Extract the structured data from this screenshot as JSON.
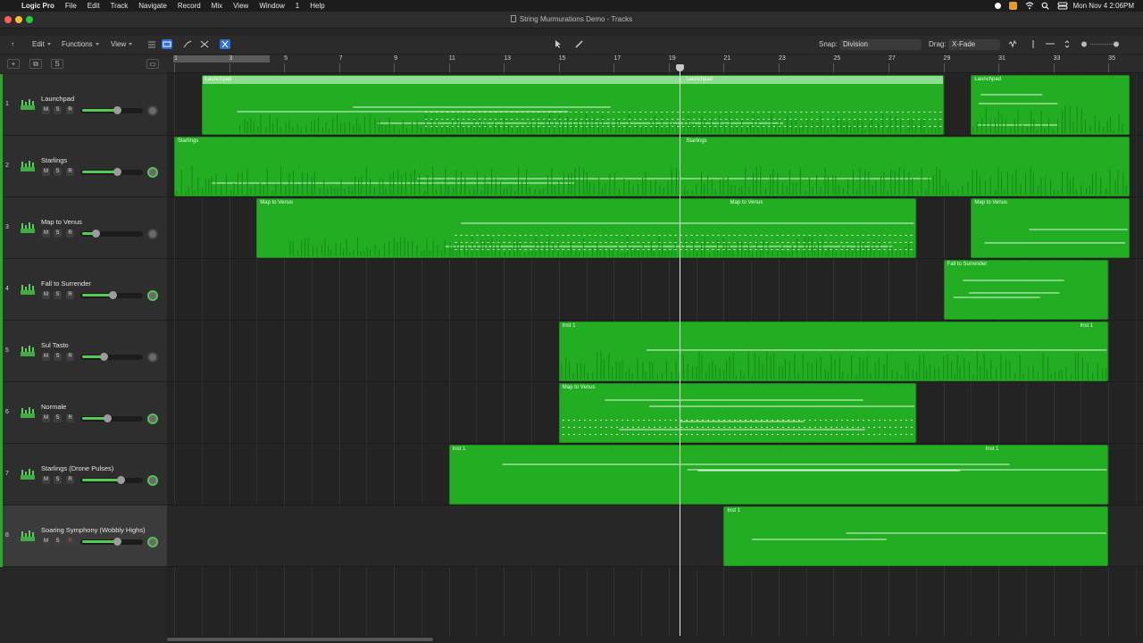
{
  "menubar": {
    "app_name": "Logic Pro",
    "items": [
      "File",
      "Edit",
      "Track",
      "Navigate",
      "Record",
      "Mix",
      "View",
      "Window",
      "1",
      "Help"
    ],
    "clock": "Mon Nov 4  2:06PM"
  },
  "window": {
    "title": "String Murmurations Demo - Tracks"
  },
  "toolbar": {
    "edit": "Edit",
    "functions": "Functions",
    "view": "View",
    "snap_label": "Snap:",
    "snap_value": "Division",
    "drag_label": "Drag:",
    "drag_value": "X-Fade"
  },
  "ruler": {
    "bars": [
      "1",
      "3",
      "5",
      "7",
      "9",
      "11",
      "13",
      "15",
      "17",
      "19",
      "21",
      "23",
      "25",
      "27",
      "29",
      "31",
      "33",
      "35"
    ]
  },
  "tracks": [
    {
      "num": "1",
      "name": "Launchpad",
      "vol": 0.62,
      "pan_green": false,
      "selected": false
    },
    {
      "num": "2",
      "name": "Starlings",
      "vol": 0.62,
      "pan_green": true,
      "selected": false
    },
    {
      "num": "3",
      "name": "Map to Venus",
      "vol": 0.25,
      "pan_green": false,
      "selected": false
    },
    {
      "num": "4",
      "name": "Fall to Surrender",
      "vol": 0.55,
      "pan_green": true,
      "selected": false
    },
    {
      "num": "5",
      "name": "Sul Tasto",
      "vol": 0.4,
      "pan_green": false,
      "selected": false
    },
    {
      "num": "6",
      "name": "Normale",
      "vol": 0.45,
      "pan_green": true,
      "selected": false
    },
    {
      "num": "7",
      "name": "Starlings (Drone Pulses)",
      "vol": 0.68,
      "pan_green": true,
      "selected": false
    },
    {
      "num": "8",
      "name": "Soaring Symphony (Wobbly Highs)",
      "vol": 0.62,
      "pan_green": true,
      "selected": true
    }
  ],
  "regions": [
    {
      "track": 0,
      "x1": "2",
      "x2": "29",
      "labels": [
        "Launchpad",
        "Launchpad"
      ],
      "selected": true,
      "density": "mixed"
    },
    {
      "track": 0,
      "x1": "30",
      "x2": "36",
      "labels": [
        "Launchpad"
      ],
      "selected": false,
      "density": "dense"
    },
    {
      "track": 1,
      "x1": "1",
      "x2": "36",
      "labels": [
        "Starlings",
        "Starlings"
      ],
      "selected": false,
      "density": "dense"
    },
    {
      "track": 2,
      "x1": "4",
      "x2": "28",
      "labels": [
        "Map to Venus",
        "Map to Venus"
      ],
      "selected": false,
      "density": "mixed"
    },
    {
      "track": 2,
      "x1": "30",
      "x2": "36",
      "labels": [
        "Map to Venus"
      ],
      "selected": false,
      "density": "lines"
    },
    {
      "track": 3,
      "x1": "29",
      "x2": "35",
      "labels": [
        "Fall to Surrender"
      ],
      "selected": false,
      "density": "lines"
    },
    {
      "track": 4,
      "x1": "15",
      "x2": "35",
      "labels": [
        "Inst 1",
        "Inst 1"
      ],
      "selected": false,
      "density": "dense"
    },
    {
      "track": 5,
      "x1": "15",
      "x2": "28",
      "labels": [
        "Map to Venus"
      ],
      "selected": false,
      "density": "dots"
    },
    {
      "track": 6,
      "x1": "11",
      "x2": "35",
      "labels": [
        "Inst 1",
        "Inst 1"
      ],
      "selected": false,
      "density": "lines"
    },
    {
      "track": 7,
      "x1": "21",
      "x2": "35",
      "labels": [
        "Inst 1"
      ],
      "selected": false,
      "density": "lines"
    }
  ],
  "playhead_bar": "19.4",
  "colors": {
    "region": "#22ad22",
    "accent": "#2f6fd6"
  }
}
